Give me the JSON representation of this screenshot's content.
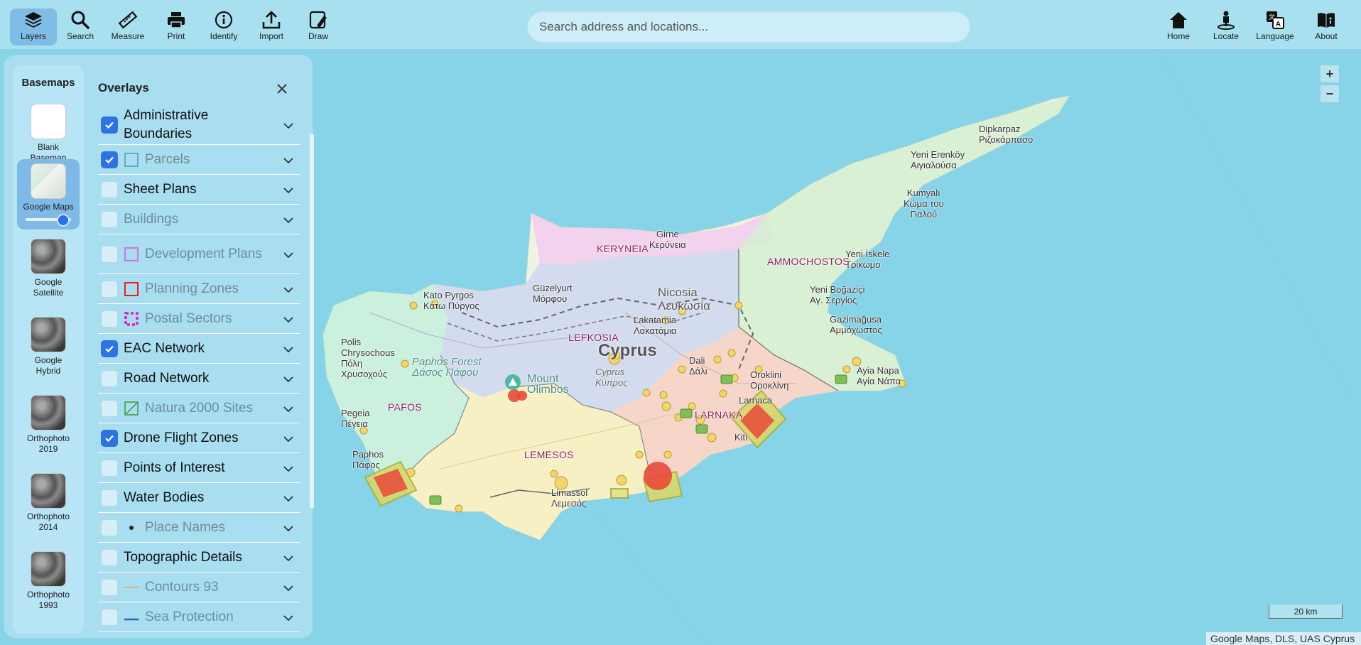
{
  "toolbar": {
    "items": [
      {
        "label": "Layers",
        "icon": "layers-icon"
      },
      {
        "label": "Search",
        "icon": "search-icon"
      },
      {
        "label": "Measure",
        "icon": "ruler-icon"
      },
      {
        "label": "Print",
        "icon": "printer-icon"
      },
      {
        "label": "Identify",
        "icon": "info-icon"
      },
      {
        "label": "Import",
        "icon": "upload-icon"
      },
      {
        "label": "Draw",
        "icon": "draw-icon"
      }
    ],
    "right_items": [
      {
        "label": "Home",
        "icon": "home-icon"
      },
      {
        "label": "Locate",
        "icon": "locate-icon"
      },
      {
        "label": "Language",
        "icon": "translate-icon"
      },
      {
        "label": "About",
        "icon": "book-icon"
      }
    ]
  },
  "search": {
    "placeholder": "Search address and locations..."
  },
  "basemaps": {
    "title": "Basemaps",
    "items": [
      {
        "label": "Blank Basemap"
      },
      {
        "label": "Google Maps",
        "active": true,
        "opacity": 0.7
      },
      {
        "label": "Google Satellite"
      },
      {
        "label": "Google Hybrid"
      },
      {
        "label": "Orthophoto 2019"
      },
      {
        "label": "Orthophoto 2014"
      },
      {
        "label": "Orthophoto 1993"
      }
    ]
  },
  "overlays": {
    "title": "Overlays",
    "items": [
      {
        "label": "Administrative Boundaries",
        "checked": true,
        "enabled": true
      },
      {
        "label": "Parcels",
        "checked": true,
        "enabled": false,
        "symbol": "square-teal"
      },
      {
        "label": "Sheet Plans",
        "checked": false,
        "enabled": true
      },
      {
        "label": "Buildings",
        "checked": false,
        "enabled": false
      },
      {
        "label": "Development Plans",
        "checked": false,
        "enabled": false,
        "symbol": "square-purple"
      },
      {
        "label": "Planning Zones",
        "checked": false,
        "enabled": false,
        "symbol": "square-red"
      },
      {
        "label": "Postal Sectors",
        "checked": false,
        "enabled": false,
        "symbol": "square-magenta-dashed"
      },
      {
        "label": "EAC Network",
        "checked": true,
        "enabled": true
      },
      {
        "label": "Road Network",
        "checked": false,
        "enabled": true
      },
      {
        "label": "Natura 2000 Sites",
        "checked": false,
        "enabled": false,
        "symbol": "hatch-green"
      },
      {
        "label": "Drone Flight Zones",
        "checked": true,
        "enabled": true
      },
      {
        "label": "Points of Interest",
        "checked": false,
        "enabled": true
      },
      {
        "label": "Water Bodies",
        "checked": false,
        "enabled": true
      },
      {
        "label": "Place Names",
        "checked": false,
        "enabled": false,
        "symbol": "dot"
      },
      {
        "label": "Topographic Details",
        "checked": false,
        "enabled": true
      },
      {
        "label": "Contours 93",
        "checked": false,
        "enabled": false,
        "symbol": "line-orange"
      },
      {
        "label": "Sea Protection",
        "checked": false,
        "enabled": false,
        "symbol": "line-blue"
      }
    ]
  },
  "map": {
    "labels": {
      "dipkarpaz": "Dipkarpaz\nΡιζοκάρπασο",
      "yeni_erenkoy": "Yeni Erenköy\nΑιγιαλούσα",
      "kumyali": "Kumyalı\nΚώμα του\nΓιαλού",
      "girne": "Girne\nΚερύνεια",
      "keryneia": "KERYNEIA",
      "ammochostos": "AMMOCHOSTOS",
      "yeni_iskele": "Yeni İskele\nΤρίκωμο",
      "guzelyurt": "Güzelyurt\nΜόρφου",
      "kato_pyrgos": "Kato Pyrgos\nΚάτω Πύργος",
      "nicosia": "Nicosia\nΛευκωσία",
      "yeni_bogazici": "Yeni Boğaziçi\nΑγ. Σεργίος",
      "gazimagusa": "Gazimağusa\nΑμμόχωστος",
      "lakatamia": "Lakatamia\nΛακατάμια",
      "lefkosia": "LEFKOSIA",
      "polis": "Polis\nChrysochous\nΠόλη\nΧρυσοχούς",
      "paphos_forest": "Paphos Forest\nΔάσος Πάφου",
      "cyprus": "Cyprus",
      "cyprus_sub": "Cyprus\nΚύπρος",
      "dali": "Dali\nΔάλι",
      "oroklini": "Oroklini\nΟροκλίνη",
      "ayia_napa": "Ayia Napa\nΑγία Νάπα",
      "mount_olimbos": "Mount\nOlimbos",
      "pegeia": "Pegeia\nΠέγεια",
      "pafos": "PAFOS",
      "larnaka_town": "Larnaca",
      "larnaka": "LARNAKA",
      "kiti": "Kiti",
      "lemesos": "LEMESOS",
      "paphos_town": "Paphos\nΠάφος",
      "limassol": "Limassol\nΛεμεσός"
    },
    "zoom_in": "+",
    "zoom_out": "−",
    "scale": "20 km",
    "attribution": "Google Maps, DLS, UAS Cyprus"
  },
  "colors": {
    "accent": "#2f74de",
    "panel": "#aadef0",
    "sea": "#87d3e8",
    "drone_zone_fill": "#e84a3a",
    "drone_zone_border": "#c8d24a"
  }
}
